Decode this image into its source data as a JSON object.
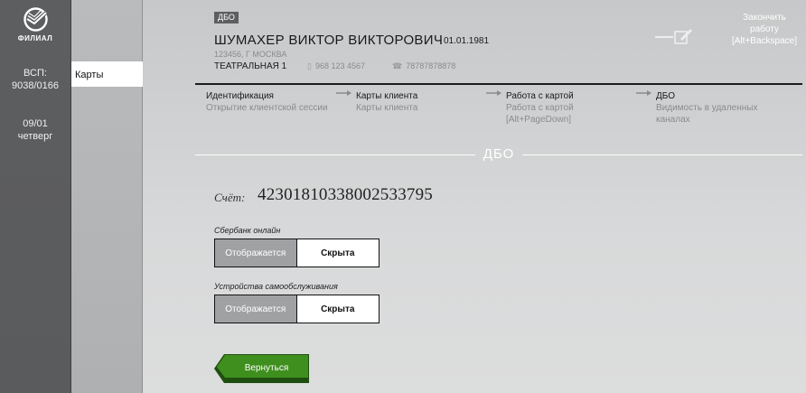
{
  "sidebar": {
    "logo_text": "ФИЛИАЛ",
    "vsp_label": "ВСП:",
    "vsp_value": "9038/0166",
    "date": "09/01",
    "weekday": "четверг"
  },
  "menu": {
    "items": [
      {
        "label": "Карты",
        "active": true
      }
    ]
  },
  "header": {
    "tag": "ДБО",
    "client_name": "ШУМАХЕР ВИКТОР ВИКТОРОВИЧ",
    "dob": "01.01.1981",
    "address": "123456, Г МОСКВА",
    "street": "ТЕАТРАЛЬНАЯ 1",
    "phone_mobile": "968 123 4567",
    "phone_home": "78787878878",
    "finish": {
      "line1": "Закончить",
      "line2": "работу",
      "hotkey": "[Alt+Backspace]"
    }
  },
  "steps": [
    {
      "title": "Идентификация",
      "sub1": "Открытие клиентской сессии",
      "sub2": ""
    },
    {
      "title": "Карты клиента",
      "sub1": "Карты клиента",
      "sub2": ""
    },
    {
      "title": "Работа с картой",
      "sub1": "Работа с картой",
      "sub2": "[Alt+PageDown]"
    },
    {
      "title": "ДБО",
      "sub1": "Видимость в удаленных",
      "sub2": "каналах"
    }
  ],
  "section": {
    "title": "ДБО",
    "account_label": "Счёт:",
    "account_number": "42301810338002533795",
    "groups": [
      {
        "label": "Сбербанк онлайн",
        "on_label": "Отображается",
        "off_label": "Скрыта",
        "selected": "Отображается"
      },
      {
        "label": "Устройства самообслуживания",
        "on_label": "Отображается",
        "off_label": "Скрыта",
        "selected": "Отображается"
      }
    ],
    "back_button": "Вернуться"
  },
  "colors": {
    "sidebar": "#5d5e60",
    "accent_green": "#3f8f1f",
    "toggle_selected": "#9fa1a3"
  }
}
